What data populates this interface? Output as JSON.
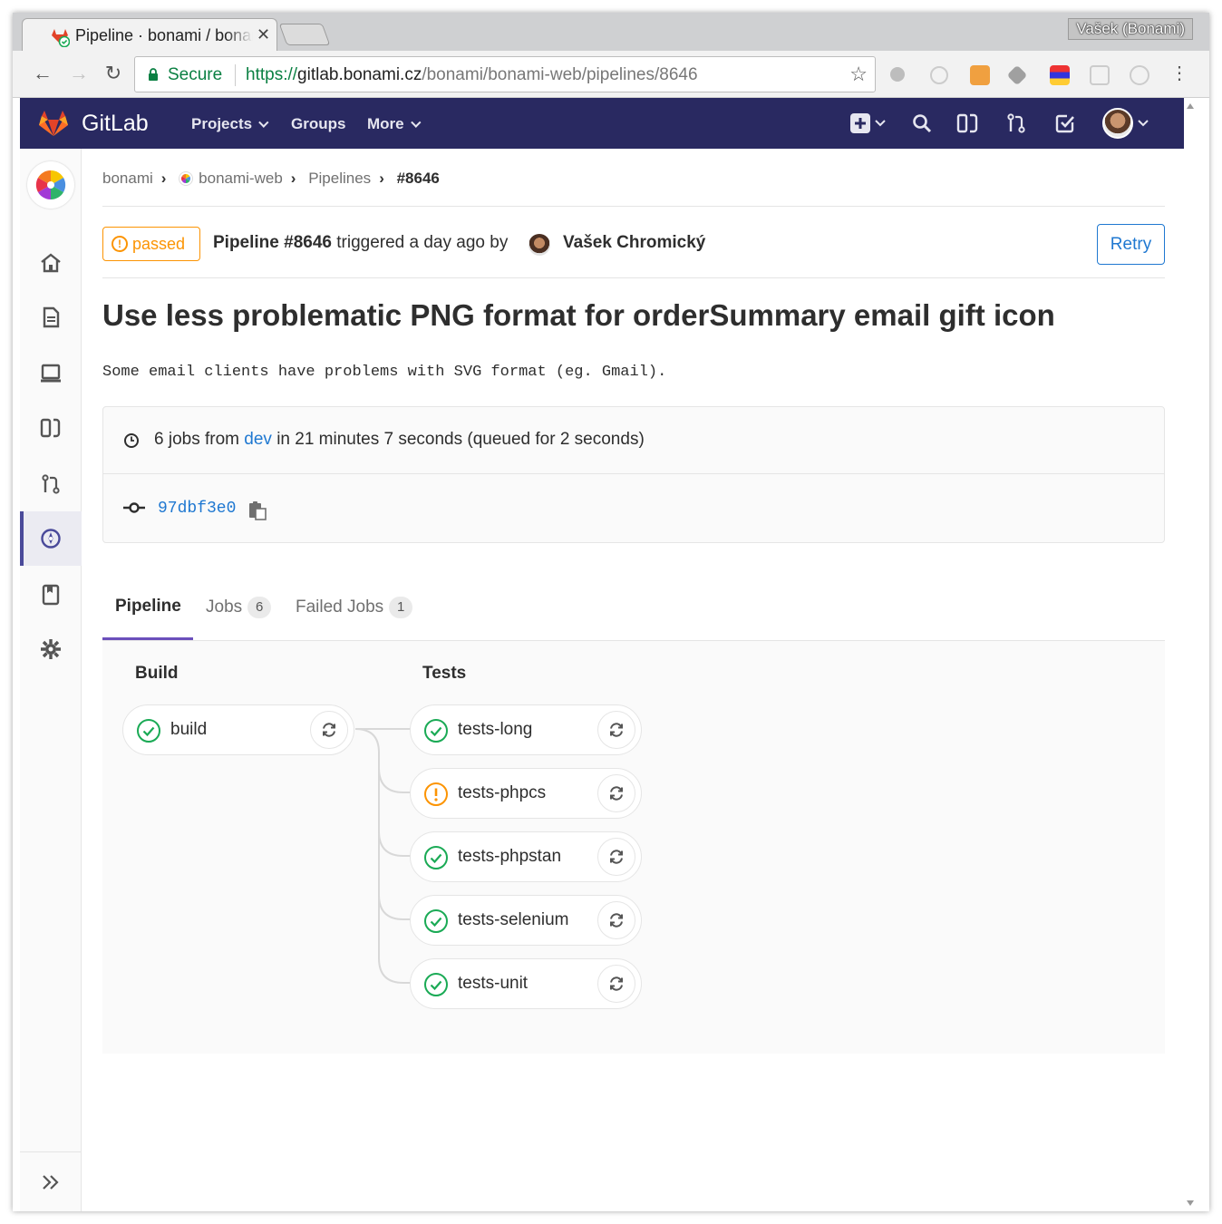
{
  "browser": {
    "tab_title": "Pipeline · bonami / bonami-web",
    "profile_label": "Vašek (Bonami)",
    "secure_label": "Secure",
    "url_protocol": "https://",
    "url_host": "gitlab.bonami.cz",
    "url_path": "/bonami/bonami-web/pipelines/8646"
  },
  "header": {
    "brand": "GitLab",
    "nav": [
      "Projects",
      "Groups",
      "More"
    ]
  },
  "breadcrumb": {
    "group": "bonami",
    "project": "bonami-web",
    "section": "Pipelines",
    "current": "#8646"
  },
  "pipeline": {
    "status": "passed",
    "title": "Pipeline #8646",
    "triggered_text": "triggered a day ago by",
    "author": "Vašek Chromický",
    "retry_label": "Retry",
    "commit_title": "Use less problematic PNG format for orderSummary email gift icon",
    "commit_description": "Some email clients have problems with SVG format (eg. Gmail).",
    "jobs_summary_prefix": "6 jobs from",
    "branch": "dev",
    "jobs_summary_suffix": "in 21 minutes 7 seconds (queued for 2 seconds)",
    "commit_sha": "97dbf3e0"
  },
  "tabs": [
    {
      "label": "Pipeline",
      "count": null
    },
    {
      "label": "Jobs",
      "count": "6"
    },
    {
      "label": "Failed Jobs",
      "count": "1"
    }
  ],
  "stages": [
    {
      "title": "Build",
      "jobs": [
        {
          "name": "build",
          "status": "success"
        }
      ]
    },
    {
      "title": "Tests",
      "jobs": [
        {
          "name": "tests-long",
          "status": "success"
        },
        {
          "name": "tests-phpcs",
          "status": "warning"
        },
        {
          "name": "tests-phpstan",
          "status": "success"
        },
        {
          "name": "tests-selenium",
          "status": "success"
        },
        {
          "name": "tests-unit",
          "status": "success"
        }
      ]
    }
  ],
  "colors": {
    "header_bg": "#292961",
    "success": "#1aaa55",
    "warning": "#fc9403",
    "link": "#1f78d1",
    "active_tab": "#6b4fbb"
  }
}
